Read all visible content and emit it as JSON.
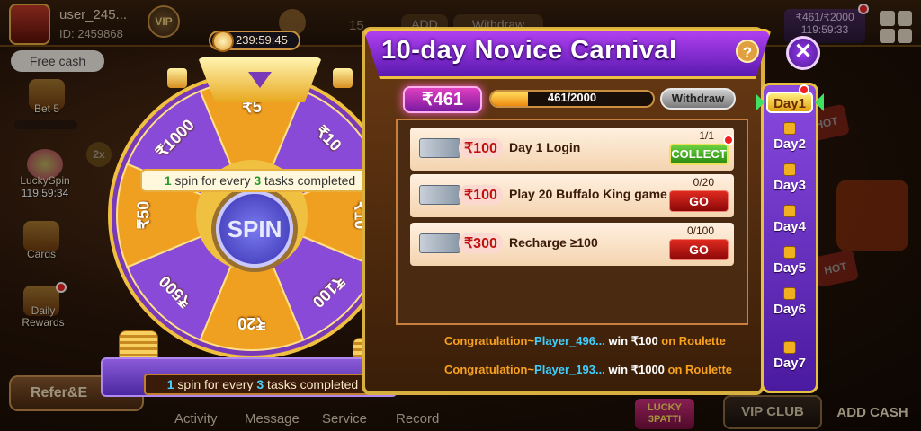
{
  "lobby": {
    "username": "user_245...",
    "user_id": "ID: 2459868",
    "vip_label": "VIP",
    "free_cash": "Free cash",
    "bet_label": "Bet 5",
    "lucky_spin_label": "LuckySpin",
    "lucky_spin_timer": "119:59:34",
    "cards_label": "Cards",
    "daily_rewards_label": "Daily Rewards",
    "refer_label": "Refer&E",
    "count_15": "15",
    "add_label": "ADD",
    "withdraw_tab": "Withdraw",
    "top_progress": "₹461/₹2000",
    "top_timer": "119:59:33",
    "nav": {
      "activity": "Activity",
      "message": "Message",
      "service": "Service",
      "record": "Record"
    },
    "vip_club": "VIP CLUB",
    "add_cash": "ADD CASH",
    "lucky_3patti": "LUCKY 3PATTI",
    "hot1": "HOT",
    "hot2": "HOT",
    "multiplier": "2x"
  },
  "wheel": {
    "timer": "239:59:45",
    "spin_label": "SPIN",
    "segments": [
      "₹5",
      "₹10",
      "₹10",
      "₹100",
      "₹20",
      "₹500",
      "₹50",
      "₹1000"
    ],
    "tooltip_prefix": "1",
    "tooltip_mid": " spin for every ",
    "tooltip_num": "3",
    "tooltip_suffix": " tasks completed",
    "base_prefix": "1",
    "base_mid": " spin for every ",
    "base_num": "3",
    "base_suffix": " tasks completed"
  },
  "carnival": {
    "title": "10-day Novice Carnival",
    "help_icon_label": "?",
    "close_label": "✕",
    "balance": "₹461",
    "progress_text": "461/2000",
    "progress_fraction": 0.2305,
    "withdraw_label": "Withdraw",
    "tasks": [
      {
        "reward": "₹100",
        "name": "Day 1 Login",
        "progress": "1/1",
        "button": "COLLECT",
        "type": "collect"
      },
      {
        "reward": "₹100",
        "name": "Play 20 Buffalo King game",
        "progress": "0/20",
        "button": "GO",
        "type": "go"
      },
      {
        "reward": "₹300",
        "name": "Recharge ≥100",
        "progress": "0/100",
        "button": "GO",
        "type": "go"
      }
    ],
    "feed": [
      {
        "prefix": "Congratulation~",
        "player": "Player_496...",
        "win": " win ",
        "amount": "₹100",
        "suffix": " on Roulette"
      },
      {
        "prefix": "Congratulation~",
        "player": "Player_193...",
        "win": " win ",
        "amount": "₹1000",
        "suffix": " on Roulette"
      }
    ],
    "days": [
      "Day1",
      "Day2",
      "Day3",
      "Day4",
      "Day5",
      "Day6",
      "Day7"
    ]
  }
}
